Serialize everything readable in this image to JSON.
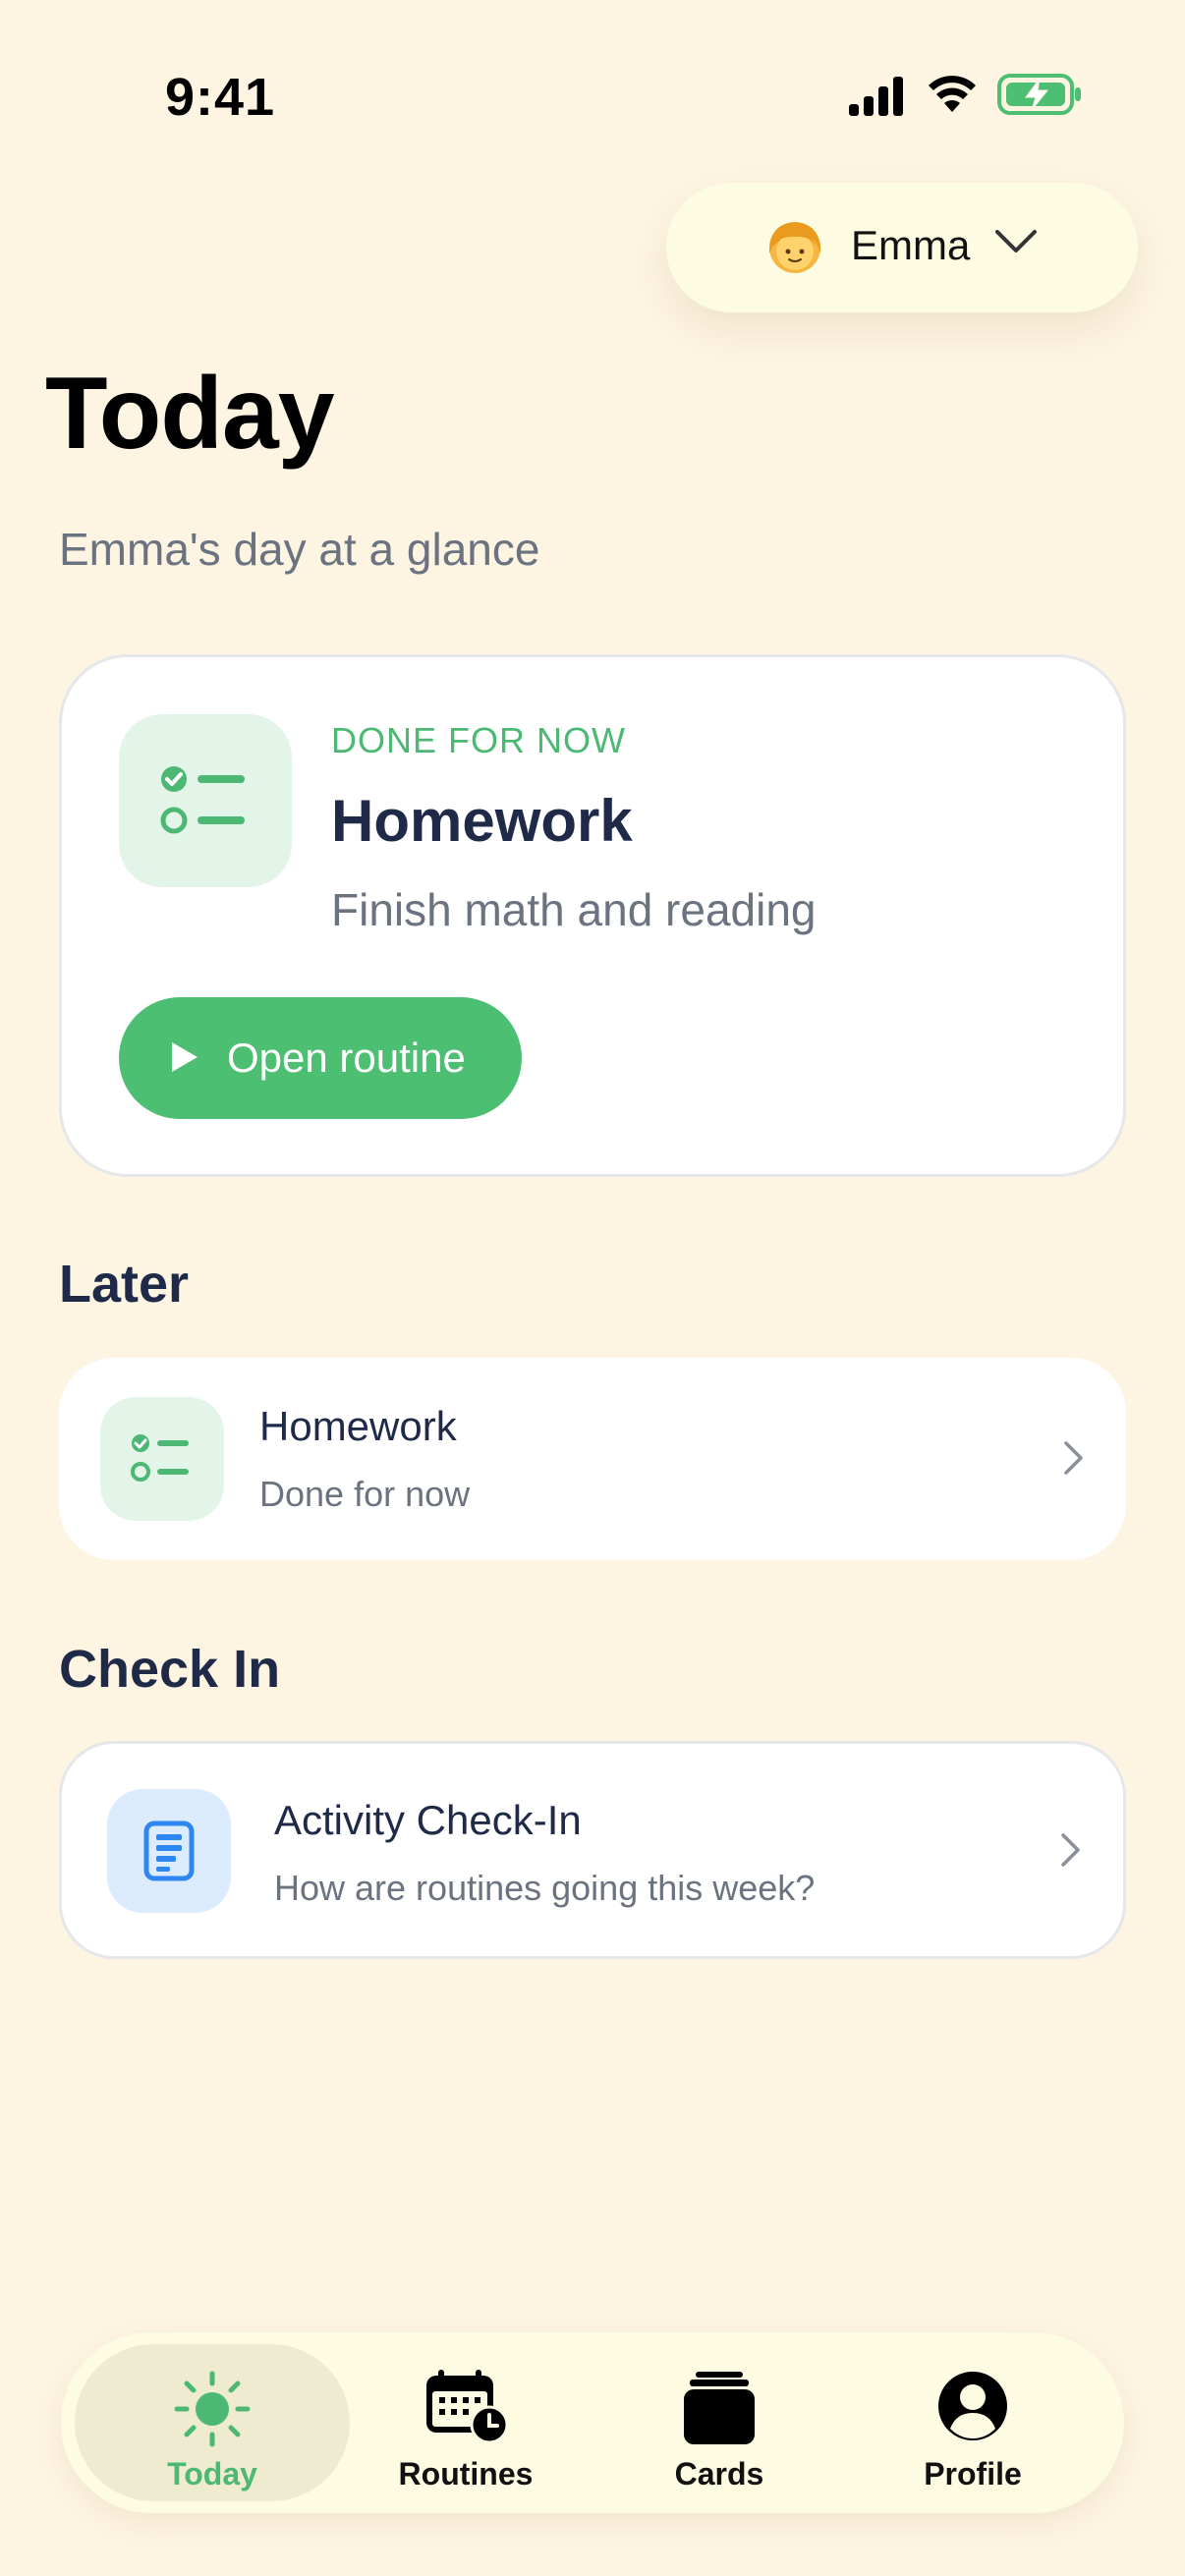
{
  "status_bar": {
    "time": "9:41"
  },
  "profile": {
    "avatar_icon": "girl-emoji-avatar",
    "name": "Emma"
  },
  "header": {
    "title": "Today",
    "subtitle": "Emma's day at a glance"
  },
  "hero": {
    "icon": "checklist-icon",
    "status": "DONE FOR NOW",
    "title": "Homework",
    "description": "Finish math and reading",
    "button_label": "Open routine"
  },
  "later": {
    "section_title": "Later",
    "items": [
      {
        "icon": "checklist-icon",
        "title": "Homework",
        "subtitle": "Done for now"
      }
    ]
  },
  "check_in": {
    "section_title": "Check In",
    "items": [
      {
        "icon": "document-icon",
        "title": "Activity Check-In",
        "subtitle": "How are routines going this week?"
      }
    ]
  },
  "tabs": [
    {
      "label": "Today",
      "icon": "sun-icon",
      "active": true
    },
    {
      "label": "Routines",
      "icon": "calendar-clock-icon",
      "active": false
    },
    {
      "label": "Cards",
      "icon": "cards-stack-icon",
      "active": false
    },
    {
      "label": "Profile",
      "icon": "person-circle-icon",
      "active": false
    }
  ],
  "colors": {
    "background": "#FDF4E2",
    "accent_green": "#4CBF72",
    "text_dark": "#1E2A47",
    "text_muted": "#6B7280",
    "blue_icon": "#2E86F0"
  }
}
